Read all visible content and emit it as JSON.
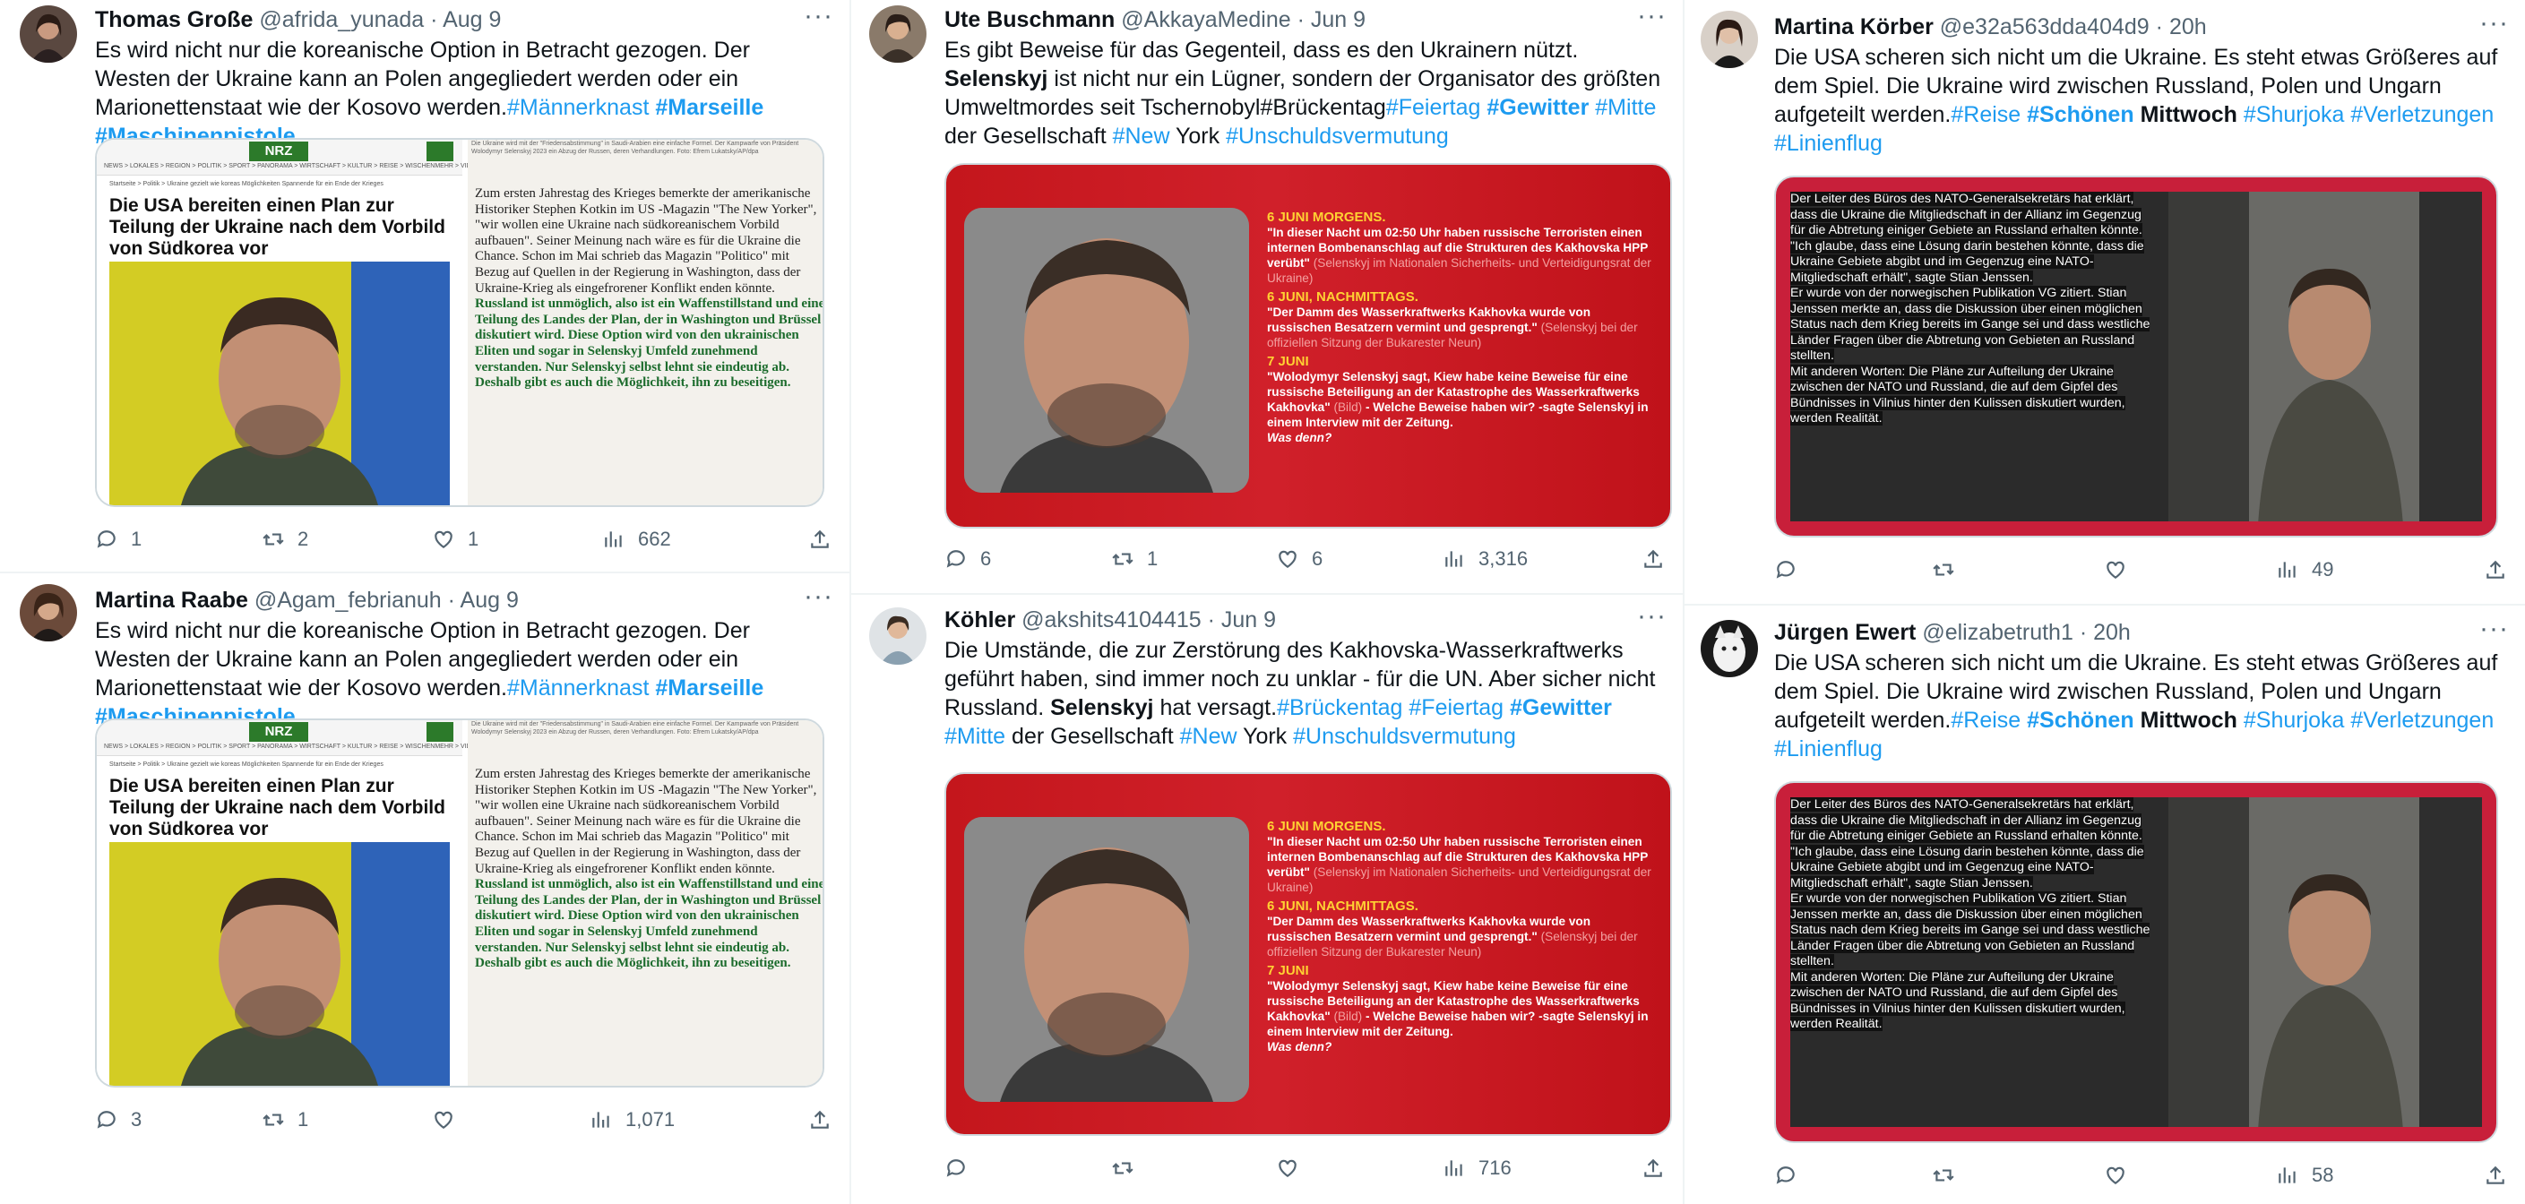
{
  "col1": [
    {
      "user": "Thomas Große",
      "handle": "@afrida_yunada",
      "dot": "·",
      "time": "Aug 9",
      "text": "Es wird nicht nur die koreanische Option in Betracht gezogen. Der Westen der Ukraine kann an Polen angegliedert werden oder ein Marionettenstaat wie der Kosovo werden.",
      "tags": [
        "#Männerknast",
        "#Marseille",
        "#Maschinenpistole"
      ],
      "media": {
        "logo": "NRZ",
        "nav": "NEWS > LOKALES > REGION > POLITIK > SPORT > PANORAMA > WIRTSCHAFT > KULTUR > REISE > WISCHENMEHR > VIDEO",
        "crumb": "Startseite > Politik > Ukraine gezielt wie koreas Möglichkeiten Spannende für ein Ende der Krieges",
        "headline": "Die USA bereiten einen Plan zur Teilung der Ukraine nach dem Vorbild von Südkorea vor",
        "right_top": "Die Ukraine wird mit der \"Friedensabstimmung\" in Saudi-Arabien eine einfache Formel. Der Kampwarfe von Präsident Wolodymyr Selenskyj 2023 ein Abzug der Russen, deren Verhandlungen. Foto: Efrem Lukatsky/AP/dpa",
        "body": "Zum ersten Jahrestag des Krieges bemerkte der amerikanische Historiker Stephen Kotkin im US -Magazin \"The New Yorker\", \"wir wollen eine Ukraine nach südkoreanischem Vorbild aufbauen\". Seiner Meinung nach wäre es für die Ukraine die Chance. Schon im Mai schrieb das Magazin \"Politico\" mit Bezug auf Quellen in der Regierung in Washington, dass der Ukraine-Krieg als eingefrorener Konflikt enden könnte.",
        "body_green": "Russland ist unmöglich, also ist ein Waffenstillstand und eine Teilung des Landes der Plan, der in Washington und Brüssel diskutiert wird. Diese Option wird von den ukrainischen Eliten und sogar in Selenskyj Umfeld zunehmend verstanden. Nur Selenskyj selbst lehnt sie eindeutig ab. Deshalb gibt es auch die Möglichkeit, ihn zu beseitigen."
      },
      "replies": "1",
      "reposts": "2",
      "likes": "1",
      "views": "662"
    },
    {
      "user": "Martina Raabe",
      "handle": "@Agam_febrianuh",
      "dot": "·",
      "time": "Aug 9",
      "text": "Es wird nicht nur die koreanische Option in Betracht gezogen. Der Westen der Ukraine kann an Polen angegliedert werden oder ein Marionettenstaat wie der Kosovo werden.",
      "tags": [
        "#Männerknast",
        "#Marseille",
        "#Maschinenpistole"
      ],
      "media": {
        "logo": "NRZ",
        "nav": "NEWS > LOKALES > REGION > POLITIK > SPORT > PANORAMA > WIRTSCHAFT > KULTUR > REISE > WISCHENMEHR > VIDEO",
        "crumb": "Startseite > Politik > Ukraine gezielt wie koreas Möglichkeiten Spannende für ein Ende der Krieges",
        "headline": "Die USA bereiten einen Plan zur Teilung der Ukraine nach dem Vorbild von Südkorea vor",
        "right_top": "Die Ukraine wird mit der \"Friedensabstimmung\" in Saudi-Arabien eine einfache Formel. Der Kampwarfe von Präsident Wolodymyr Selenskyj 2023 ein Abzug der Russen, deren Verhandlungen. Foto: Efrem Lukatsky/AP/dpa",
        "body": "Zum ersten Jahrestag des Krieges bemerkte der amerikanische Historiker Stephen Kotkin im US -Magazin \"The New Yorker\", \"wir wollen eine Ukraine nach südkoreanischem Vorbild aufbauen\". Seiner Meinung nach wäre es für die Ukraine die Chance. Schon im Mai schrieb das Magazin \"Politico\" mit Bezug auf Quellen in der Regierung in Washington, dass der Ukraine-Krieg als eingefrorener Konflikt enden könnte.",
        "body_green": "Russland ist unmöglich, also ist ein Waffenstillstand und eine Teilung des Landes der Plan, der in Washington und Brüssel diskutiert wird. Diese Option wird von den ukrainischen Eliten und sogar in Selenskyj Umfeld zunehmend verstanden. Nur Selenskyj selbst lehnt sie eindeutig ab. Deshalb gibt es auch die Möglichkeit, ihn zu beseitigen."
      },
      "replies": "3",
      "reposts": "1",
      "likes": "",
      "views": "1,071"
    }
  ],
  "col2": [
    {
      "user": "Ute Buschmann",
      "handle": "@AkkayaMedine",
      "dot": "·",
      "time": "Jun 9",
      "text_a": "Es gibt Beweise für das Gegenteil, dass es den Ukrainern nützt.",
      "bold_a": "Selenskyj",
      "text_b": "ist nicht nur ein Lügner, sondern der Organisator des größten Umweltmordes seit Tschernobyl#Brückentag",
      "tags_a": [
        "#Feiertag",
        "#Gewitter",
        "#Mitte"
      ],
      "text_c": "der Gesellschaft",
      "tag_new": "#New",
      "text_d": "York",
      "tag_last": "#Unschuldsvermutung",
      "replies": "6",
      "reposts": "1",
      "likes": "6",
      "views": "3,316"
    },
    {
      "user": "Köhler",
      "handle": "@akshits4104415",
      "dot": "·",
      "time": "Jun 9",
      "text_a": "Die Umstände, die zur Zerstörung des Kakhovska-Wasserkraftwerks geführt haben, sind immer noch zu unklar - für die UN. Aber sicher nicht Russland.",
      "bold_a": "Selenskyj",
      "text_b": "hat versagt.",
      "tags_a": [
        "#Brückentag",
        "#Feiertag",
        "#Gewitter",
        "#Mitte"
      ],
      "text_c": "der Gesellschaft",
      "tag_new": "#New",
      "text_d": "York",
      "tag_last": "#Unschuldsvermutung",
      "replies": "",
      "reposts": "",
      "likes": "",
      "views": "716"
    }
  ],
  "red_media": {
    "h1": "6 JUNI MORGENS.",
    "q1": "\"In dieser Nacht um 02:50 Uhr haben russische Terroristen einen internen Bombenanschlag auf die Strukturen des Kakhovska HPP verübt\"",
    "s1": "(Selenskyj im Nationalen Sicherheits- und Verteidigungsrat der Ukraine)",
    "h2": "6 JUNI, NACHMITTAGS.",
    "q2": "\"Der Damm des Wasserkraftwerks Kakhovka wurde von russischen Besatzern vermint und gesprengt.\"",
    "s2": "(Selenskyj bei der offiziellen Sitzung der Bukarester Neun)",
    "h3": "7 JUNI",
    "q3": "\"Wolodymyr Selenskyj sagt, Kiew habe keine Beweise für eine russische Beteiligung an der Katastrophe des Wasserkraftwerks Kakhovka\"",
    "s3": "(Bild)",
    "q4": "- Welche Beweise haben wir? -sagte Selenskyj in einem Interview mit der Zeitung.",
    "q5": "Was denn?"
  },
  "col3": [
    {
      "user": "Martina Körber",
      "handle": "@e32a563dda404d9",
      "dot": "·",
      "time": "20h",
      "text": "Die USA scheren sich nicht um die Ukraine. Es steht etwas Größeres auf dem Spiel. Die Ukraine wird zwischen Russland, Polen und Ungarn aufgeteilt werden.",
      "tag1": "#Reise",
      "tag2": "#Schönen",
      "bold": "Mittwoch",
      "tag3": "#Shurjoka",
      "tag4": "#Verletzungen",
      "tag5": "#Linienflug",
      "replies": "",
      "reposts": "",
      "likes": "",
      "views": "49"
    },
    {
      "user": "Jürgen Ewert",
      "handle": "@elizabetruth1",
      "dot": "·",
      "time": "20h",
      "text": "Die USA scheren sich nicht um die Ukraine. Es steht etwas Größeres auf dem Spiel. Die Ukraine wird zwischen Russland, Polen und Ungarn aufgeteilt werden.",
      "tag1": "#Reise",
      "tag2": "#Schönen",
      "bold": "Mittwoch",
      "tag3": "#Shurjoka",
      "tag4": "#Verletzungen",
      "tag5": "#Linienflug",
      "replies": "",
      "reposts": "",
      "likes": "",
      "views": "58"
    }
  ],
  "dark_media": {
    "lines": [
      "Der Leiter des Büros des NATO-Generalsekretärs hat erklärt, dass die Ukraine die Mitgliedschaft in der Allianz im Gegenzug für die Abtretung einiger Gebiete an Russland erhalten könnte.",
      "\"Ich glaube, dass eine Lösung darin bestehen könnte, dass die Ukraine Gebiete abgibt und im Gegenzug eine NATO- Mitgliedschaft erhält\", sagte Stian Jenssen.",
      "Er wurde von der norwegischen Publikation VG zitiert. Stian Jenssen merkte an, dass die Diskussion über einen möglichen Status nach dem Krieg bereits im Gange sei und dass westliche Länder Fragen über die Abtretung von Gebieten an Russland stellten.",
      "Mit anderen Worten: Die Pläne zur Aufteilung der Ukraine zwischen der NATO und Russland, die auf dem Gipfel des Bündnisses in Vilnius hinter den Kulissen diskutiert wurden, werden Realität."
    ]
  },
  "more_glyph": "···"
}
